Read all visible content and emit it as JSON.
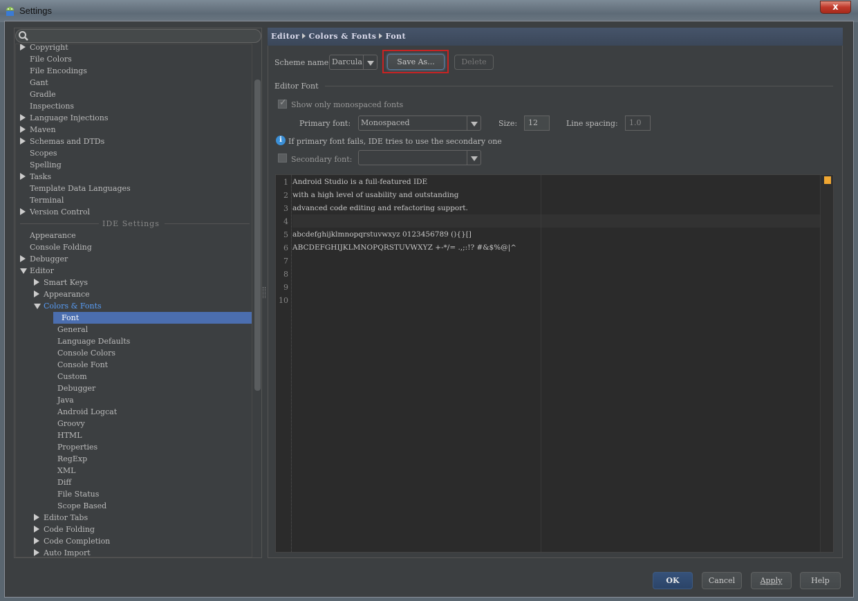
{
  "window": {
    "title": "Settings",
    "close_icon": "close-icon"
  },
  "sidebar": {
    "search_placeholder": "",
    "items": [
      {
        "label": "Copyright",
        "level": 0,
        "arrow": "right"
      },
      {
        "label": "File Colors",
        "level": 0
      },
      {
        "label": "File Encodings",
        "level": 0
      },
      {
        "label": "Gant",
        "level": 0
      },
      {
        "label": "Gradle",
        "level": 0
      },
      {
        "label": "Inspections",
        "level": 0
      },
      {
        "label": "Language Injections",
        "level": 0,
        "arrow": "right"
      },
      {
        "label": "Maven",
        "level": 0,
        "arrow": "right"
      },
      {
        "label": "Schemas and DTDs",
        "level": 0,
        "arrow": "right"
      },
      {
        "label": "Scopes",
        "level": 0
      },
      {
        "label": "Spelling",
        "level": 0
      },
      {
        "label": "Tasks",
        "level": 0,
        "arrow": "right"
      },
      {
        "label": "Template Data Languages",
        "level": 0
      },
      {
        "label": "Terminal",
        "level": 0
      },
      {
        "label": "Version Control",
        "level": 0,
        "arrow": "right"
      },
      {
        "separator": "IDE Settings"
      },
      {
        "label": "Appearance",
        "level": 0
      },
      {
        "label": "Console Folding",
        "level": 0
      },
      {
        "label": "Debugger",
        "level": 0,
        "arrow": "right"
      },
      {
        "label": "Editor",
        "level": 0,
        "arrow": "down"
      },
      {
        "label": "Smart Keys",
        "level": 1,
        "arrow": "right"
      },
      {
        "label": "Appearance",
        "level": 1,
        "arrow": "right"
      },
      {
        "label": "Colors & Fonts",
        "level": 1,
        "arrow": "down",
        "highlight": true
      },
      {
        "label": "Font",
        "level": 2,
        "selected": true
      },
      {
        "label": "General",
        "level": 2
      },
      {
        "label": "Language Defaults",
        "level": 2
      },
      {
        "label": "Console Colors",
        "level": 2
      },
      {
        "label": "Console Font",
        "level": 2
      },
      {
        "label": "Custom",
        "level": 2
      },
      {
        "label": "Debugger",
        "level": 2
      },
      {
        "label": "Java",
        "level": 2
      },
      {
        "label": "Android Logcat",
        "level": 2
      },
      {
        "label": "Groovy",
        "level": 2
      },
      {
        "label": "HTML",
        "level": 2
      },
      {
        "label": "Properties",
        "level": 2
      },
      {
        "label": "RegExp",
        "level": 2
      },
      {
        "label": "XML",
        "level": 2
      },
      {
        "label": "Diff",
        "level": 2
      },
      {
        "label": "File Status",
        "level": 2
      },
      {
        "label": "Scope Based",
        "level": 2
      },
      {
        "label": "Editor Tabs",
        "level": 1,
        "arrow": "right"
      },
      {
        "label": "Code Folding",
        "level": 1,
        "arrow": "right"
      },
      {
        "label": "Code Completion",
        "level": 1,
        "arrow": "right"
      },
      {
        "label": "Auto Import",
        "level": 1,
        "arrow": "right"
      }
    ]
  },
  "breadcrumb": [
    "Editor",
    "Colors & Fonts",
    "Font"
  ],
  "scheme": {
    "label": "Scheme name:",
    "value": "Darcula",
    "save_as": "Save As...",
    "delete": "Delete"
  },
  "editor_font": {
    "group_title": "Editor Font",
    "show_mono_label": "Show only monospaced fonts",
    "show_mono_checked": true,
    "primary_label": "Primary font:",
    "primary_value": "Monospaced",
    "size_label": "Size:",
    "size_value": "12",
    "spacing_label": "Line spacing:",
    "spacing_value": "1.0",
    "info_text": "If primary font fails, IDE tries to use the secondary one",
    "secondary_label": "Secondary font:",
    "secondary_checked": false,
    "secondary_value": ""
  },
  "preview": {
    "lines": [
      "Android Studio is a full-featured IDE",
      "with a high level of usability and outstanding",
      "advanced code editing and refactoring support.",
      "",
      "abcdefghijklmnopqrstuvwxyz 0123456789 (){}[]",
      "ABCDEFGHIJKLMNOPQRSTUVWXYZ +-*/= .,;:!? #&$%@|^",
      "",
      "",
      "",
      ""
    ],
    "line_numbers": [
      "1",
      "2",
      "3",
      "4",
      "5",
      "6",
      "7",
      "8",
      "9",
      "10"
    ],
    "marker_color": "#f0a732"
  },
  "footer": {
    "ok": "OK",
    "cancel": "Cancel",
    "apply": "Apply",
    "help": "Help"
  },
  "colors": {
    "selection": "#4b6eaf",
    "highlight_border": "#cc2222",
    "ok_button": "#2f4a6e"
  }
}
